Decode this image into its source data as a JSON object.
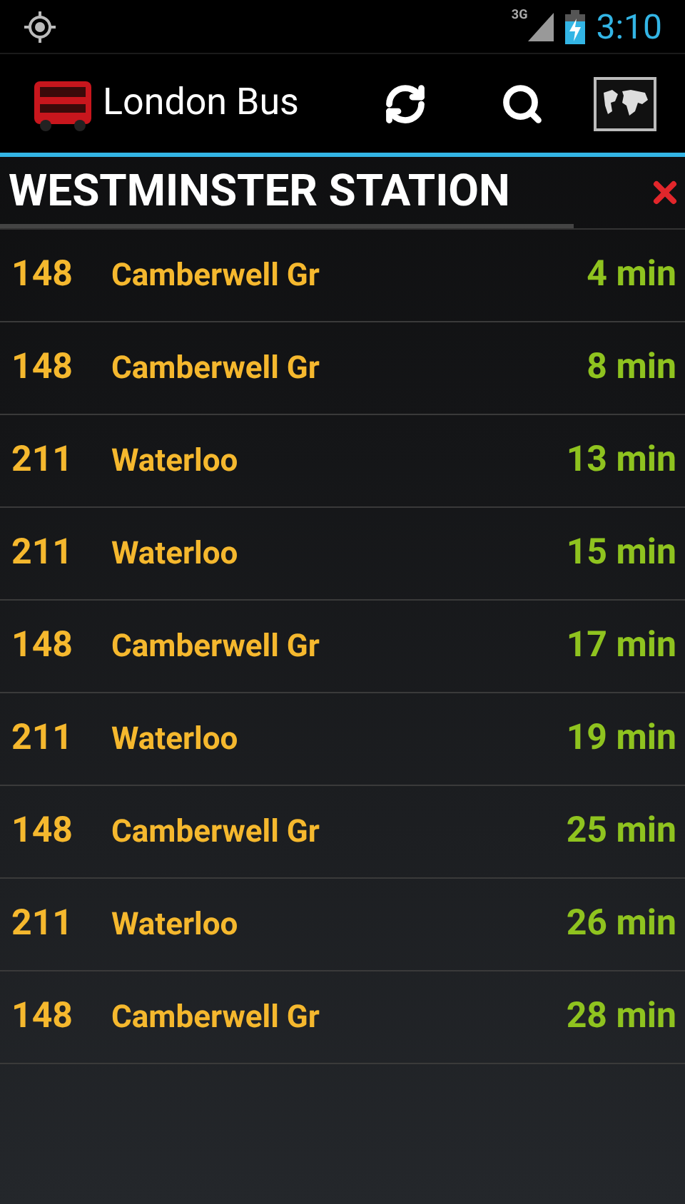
{
  "status_bar": {
    "network": "3G",
    "time": "3:10"
  },
  "action_bar": {
    "title": "London Bus"
  },
  "stop": {
    "name": "WESTMINSTER STATION"
  },
  "arrivals": [
    {
      "route": "148",
      "destination": "Camberwell Gr",
      "due": "4 min"
    },
    {
      "route": "148",
      "destination": "Camberwell Gr",
      "due": "8 min"
    },
    {
      "route": "211",
      "destination": "Waterloo",
      "due": "13 min"
    },
    {
      "route": "211",
      "destination": "Waterloo",
      "due": "15 min"
    },
    {
      "route": "148",
      "destination": "Camberwell Gr",
      "due": "17 min"
    },
    {
      "route": "211",
      "destination": "Waterloo",
      "due": "19 min"
    },
    {
      "route": "148",
      "destination": "Camberwell Gr",
      "due": "25 min"
    },
    {
      "route": "211",
      "destination": "Waterloo",
      "due": "26 min"
    },
    {
      "route": "148",
      "destination": "Camberwell Gr",
      "due": "28 min"
    }
  ]
}
